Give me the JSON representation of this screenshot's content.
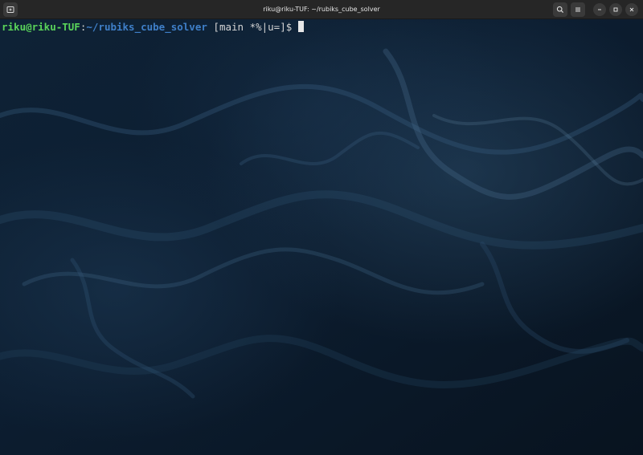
{
  "window": {
    "title": "riku@riku-TUF: ~/rubiks_cube_solver"
  },
  "titlebar": {
    "left_button_icon": "new-tab-icon",
    "right_buttons": [
      {
        "icon": "search-icon"
      },
      {
        "icon": "menu-icon"
      },
      {
        "icon": "minimize-icon"
      },
      {
        "icon": "maximize-icon"
      },
      {
        "icon": "close-icon"
      }
    ]
  },
  "terminal": {
    "prompt": {
      "user_host": "riku@riku-TUF",
      "colon": ":",
      "path": "~/rubiks_cube_solver",
      "git_status": " [main *%|u=]",
      "symbol": "$ "
    },
    "colors": {
      "user_host": "#5ad45a",
      "path": "#3f7fc8",
      "background": "#0c1b2c"
    }
  }
}
